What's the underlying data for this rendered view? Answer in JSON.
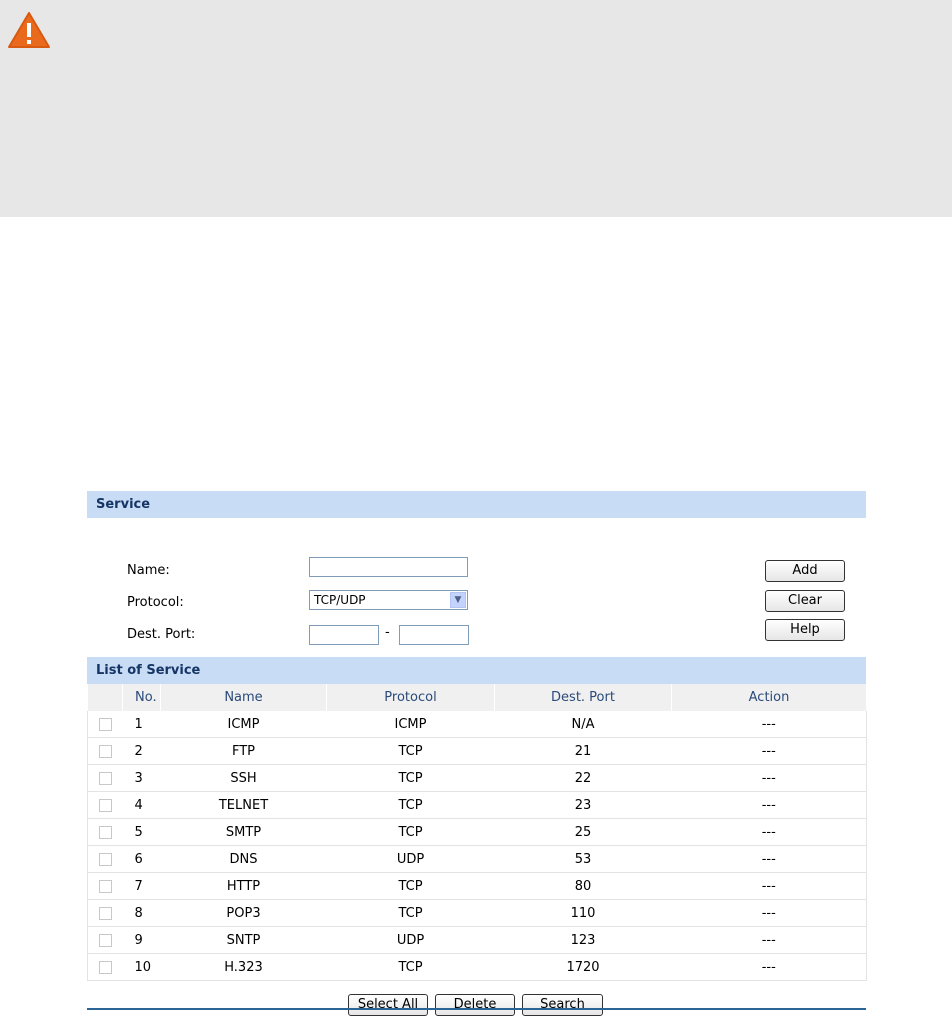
{
  "icons": {
    "warning": "warning-triangle-icon"
  },
  "service_section": {
    "title": "Service",
    "name_label": "Name:",
    "name_value": "",
    "protocol_label": "Protocol:",
    "protocol_value": "TCP/UDP",
    "dest_port_label": "Dest. Port:",
    "dest_port_from": "",
    "dest_port_separator": "-",
    "dest_port_to": "",
    "buttons": {
      "add": "Add",
      "clear": "Clear",
      "help": "Help"
    }
  },
  "list_section": {
    "title": "List of Service",
    "columns": [
      "No.",
      "Name",
      "Protocol",
      "Dest. Port",
      "Action"
    ],
    "rows": [
      {
        "no": "1",
        "name": "ICMP",
        "protocol": "ICMP",
        "dest_port": "N/A",
        "action": "---"
      },
      {
        "no": "2",
        "name": "FTP",
        "protocol": "TCP",
        "dest_port": "21",
        "action": "---"
      },
      {
        "no": "3",
        "name": "SSH",
        "protocol": "TCP",
        "dest_port": "22",
        "action": "---"
      },
      {
        "no": "4",
        "name": "TELNET",
        "protocol": "TCP",
        "dest_port": "23",
        "action": "---"
      },
      {
        "no": "5",
        "name": "SMTP",
        "protocol": "TCP",
        "dest_port": "25",
        "action": "---"
      },
      {
        "no": "6",
        "name": "DNS",
        "protocol": "UDP",
        "dest_port": "53",
        "action": "---"
      },
      {
        "no": "7",
        "name": "HTTP",
        "protocol": "TCP",
        "dest_port": "80",
        "action": "---"
      },
      {
        "no": "8",
        "name": "POP3",
        "protocol": "TCP",
        "dest_port": "110",
        "action": "---"
      },
      {
        "no": "9",
        "name": "SNTP",
        "protocol": "UDP",
        "dest_port": "123",
        "action": "---"
      },
      {
        "no": "10",
        "name": "H.323",
        "protocol": "TCP",
        "dest_port": "1720",
        "action": "---"
      }
    ],
    "buttons": {
      "select_all": "Select All",
      "delete": "Delete",
      "search": "Search"
    }
  },
  "colors": {
    "section_header_bg": "#c9dcf5",
    "section_header_text": "#153566",
    "warning_banner_bg": "#e7e7e7",
    "warning_icon": "#ea6a1d",
    "footer_line": "#2b6596"
  }
}
